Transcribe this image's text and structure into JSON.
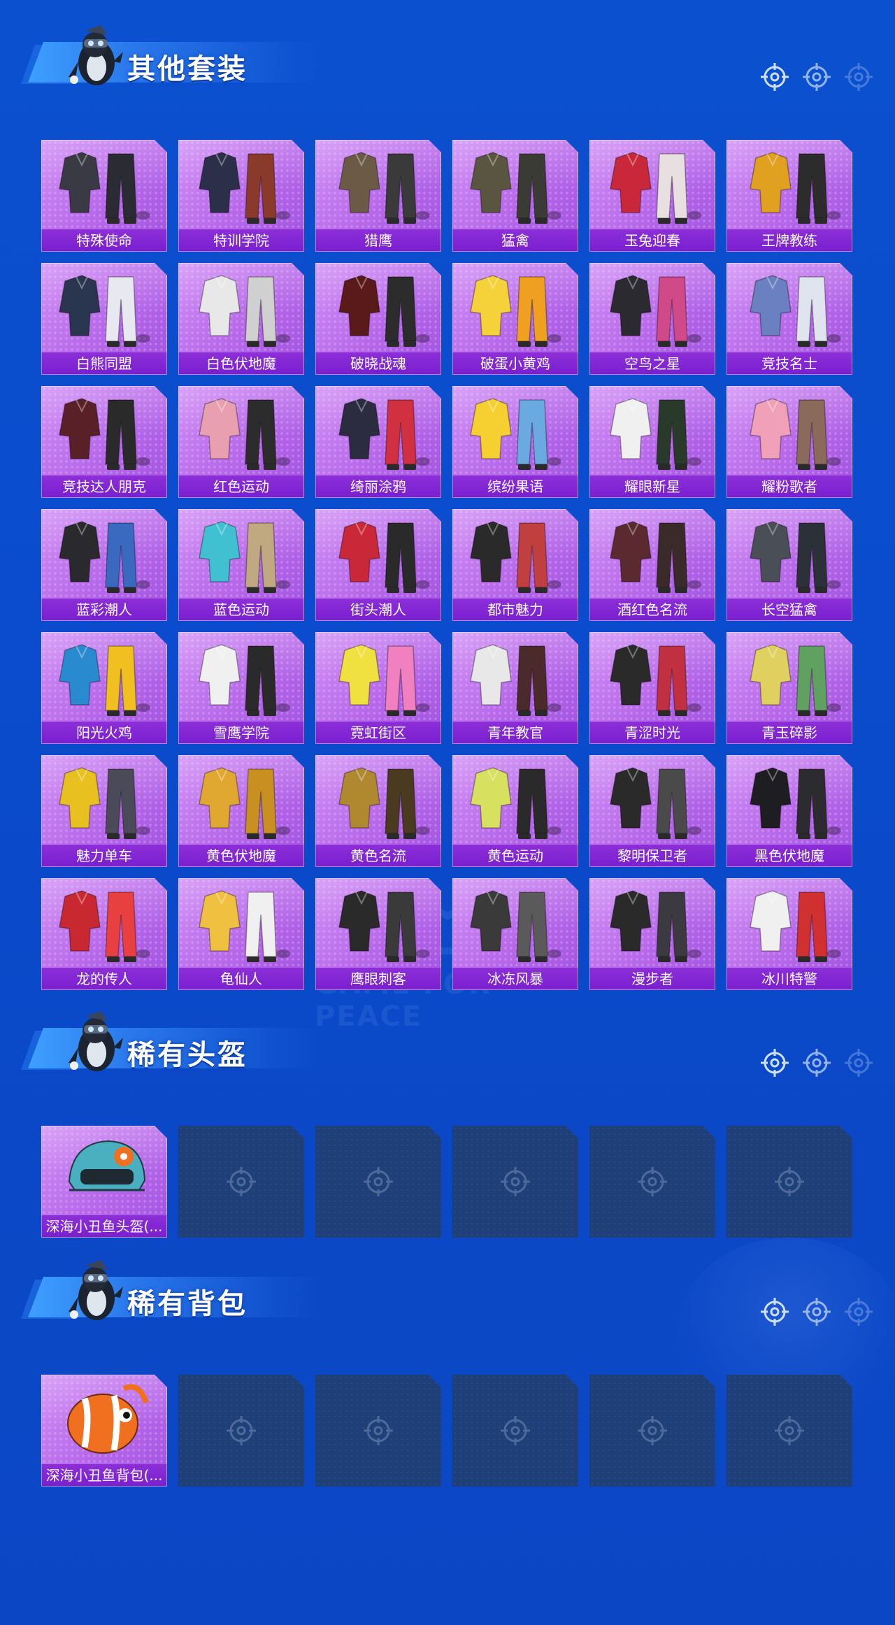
{
  "watermark": "GAME FOR PEACE",
  "sections": [
    {
      "id": "other-suits",
      "title": "其他套装",
      "items": [
        {
          "name": "特殊使命",
          "palette": [
            "#3a3a44",
            "#2b2b33"
          ]
        },
        {
          "name": "特训学院",
          "palette": [
            "#2c2f4a",
            "#8a3a2a"
          ]
        },
        {
          "name": "猎鹰",
          "palette": [
            "#6b5a45",
            "#3a3a3a"
          ]
        },
        {
          "name": "猛禽",
          "palette": [
            "#5a5540",
            "#3b3b36"
          ]
        },
        {
          "name": "玉兔迎春",
          "palette": [
            "#c8283a",
            "#e8e0e0"
          ]
        },
        {
          "name": "王牌教练",
          "palette": [
            "#e0a020",
            "#2c2c2c"
          ]
        },
        {
          "name": "白熊同盟",
          "palette": [
            "#2a3550",
            "#e8e8f0"
          ]
        },
        {
          "name": "白色伏地魔",
          "palette": [
            "#e8e8e8",
            "#d0d0d0"
          ]
        },
        {
          "name": "破晓战魂",
          "palette": [
            "#5a1a1a",
            "#2c2c2c"
          ]
        },
        {
          "name": "破蛋小黄鸡",
          "palette": [
            "#f5d23a",
            "#f0a020"
          ]
        },
        {
          "name": "空鸟之星",
          "palette": [
            "#2a2a30",
            "#d04a8a"
          ]
        },
        {
          "name": "竞技名士",
          "palette": [
            "#6a80c0",
            "#e0e4ee"
          ]
        },
        {
          "name": "竞技达人朋克",
          "palette": [
            "#5a2028",
            "#2a2a2a"
          ]
        },
        {
          "name": "红色运动",
          "palette": [
            "#e8a0b0",
            "#2c2c2c"
          ]
        },
        {
          "name": "绮丽涂鸦",
          "palette": [
            "#2c2c40",
            "#d03040"
          ]
        },
        {
          "name": "缤纷果语",
          "palette": [
            "#f5d030",
            "#6aaae0"
          ]
        },
        {
          "name": "耀眼新星",
          "palette": [
            "#f0f0f0",
            "#2a3a2a"
          ]
        },
        {
          "name": "耀粉歌者",
          "palette": [
            "#f0a0b8",
            "#8a6a5a"
          ]
        },
        {
          "name": "蓝彩潮人",
          "palette": [
            "#2a2a2e",
            "#3a6ac0"
          ]
        },
        {
          "name": "蓝色运动",
          "palette": [
            "#40c0d0",
            "#c0a880"
          ]
        },
        {
          "name": "街头潮人",
          "palette": [
            "#c82838",
            "#2a2a2a"
          ]
        },
        {
          "name": "都市魅力",
          "palette": [
            "#2a2a2a",
            "#c04040"
          ]
        },
        {
          "name": "酒红色名流",
          "palette": [
            "#5a2a30",
            "#3a2a2a"
          ]
        },
        {
          "name": "长空猛禽",
          "palette": [
            "#4a4e56",
            "#2c3038"
          ]
        },
        {
          "name": "阳光火鸡",
          "palette": [
            "#2a8ad0",
            "#f0c020"
          ]
        },
        {
          "name": "雪鹰学院",
          "palette": [
            "#f0f0f0",
            "#2a2a2a"
          ]
        },
        {
          "name": "霓虹街区",
          "palette": [
            "#f0e040",
            "#f080c0"
          ]
        },
        {
          "name": "青年教官",
          "palette": [
            "#e8e8e8",
            "#4a2a2a"
          ]
        },
        {
          "name": "青涩时光",
          "palette": [
            "#2a2a2a",
            "#c03040"
          ]
        },
        {
          "name": "青玉碎影",
          "palette": [
            "#e0d060",
            "#60a060"
          ]
        },
        {
          "name": "魅力单车",
          "palette": [
            "#e8c020",
            "#4a4a58"
          ]
        },
        {
          "name": "黄色伏地魔",
          "palette": [
            "#e0a830",
            "#c89020"
          ]
        },
        {
          "name": "黄色名流",
          "palette": [
            "#b08830",
            "#4a3a20"
          ]
        },
        {
          "name": "黄色运动",
          "palette": [
            "#d8e060",
            "#2a2a2a"
          ]
        },
        {
          "name": "黎明保卫者",
          "palette": [
            "#2a2a2a",
            "#4a4a4a"
          ]
        },
        {
          "name": "黑色伏地魔",
          "palette": [
            "#1e1e22",
            "#2c2c30"
          ]
        },
        {
          "name": "龙的传人",
          "palette": [
            "#c82830",
            "#e84040"
          ]
        },
        {
          "name": "龟仙人",
          "palette": [
            "#f0c040",
            "#f0f0f0"
          ]
        },
        {
          "name": "鹰眼刺客",
          "palette": [
            "#2a2a2a",
            "#3a3a3a"
          ]
        },
        {
          "name": "冰冻风暴",
          "palette": [
            "#3a3a3a",
            "#5a5a5a"
          ]
        },
        {
          "name": "漫步者",
          "palette": [
            "#2a2a2a",
            "#3a3a40"
          ]
        },
        {
          "name": "冰川特警",
          "palette": [
            "#f0f0f0",
            "#d03030"
          ]
        }
      ],
      "empty_slots": 0
    },
    {
      "id": "rare-helmets",
      "title": "稀有头盔",
      "items": [
        {
          "name": "深海小丑鱼头盔(...",
          "palette": [
            "#4ab0c0",
            "#f07020"
          ]
        }
      ],
      "empty_slots": 5
    },
    {
      "id": "rare-backpacks",
      "title": "稀有背包",
      "items": [
        {
          "name": "深海小丑鱼背包(...",
          "palette": [
            "#f07020",
            "#ffffff"
          ]
        }
      ],
      "empty_slots": 5
    }
  ],
  "icons": {
    "header_target": "crosshair-target-icon",
    "empty_slot": "crosshair-target-icon",
    "mascot": "penguin-mascot-icon"
  },
  "colors": {
    "background": "#0b4ccd",
    "card": "#b768ea",
    "label_bar": "#8a2ed6",
    "empty_slot": "#1f3f78"
  }
}
